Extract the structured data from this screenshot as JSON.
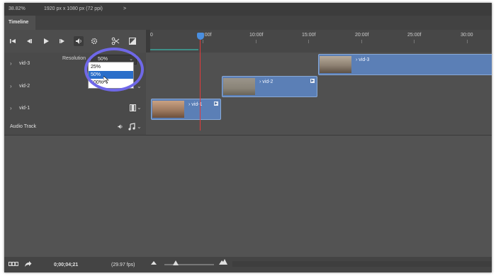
{
  "status": {
    "zoom": "38.82%",
    "doc_info": "1920 px x 1080 px (72 ppi)",
    "arrow": ">"
  },
  "tabs": [
    {
      "label": "Timeline"
    }
  ],
  "controls": {
    "icons": [
      "first-frame-icon",
      "previous-frame-icon",
      "play-icon",
      "next-frame-icon",
      "speaker-icon",
      "gear-icon",
      "scissors-icon",
      "transition-icon"
    ]
  },
  "ruler": {
    "ticks": [
      "00",
      "05:00f",
      "10:00f",
      "15:00f",
      "20:00f",
      "25:00f",
      "30:00"
    ]
  },
  "resolution": {
    "label": "Resolution",
    "selected": "50%",
    "options": [
      "25%",
      "50%",
      "100%"
    ],
    "highlighted_index": 1
  },
  "tracks": [
    {
      "name": "vid-3"
    },
    {
      "name": "vid-2"
    },
    {
      "name": "vid-1"
    },
    {
      "name": "Audio Track"
    }
  ],
  "clips": [
    {
      "label": "vid-3"
    },
    {
      "label": "vid-2"
    },
    {
      "label": "vid-1"
    }
  ],
  "bottom": {
    "timecode": "0;00;04;21",
    "fps": "(29.97 fps)"
  },
  "colors": {
    "accent": "#6f68e8",
    "playhead": "#e23a3a",
    "clip": "#5b7fb6",
    "selection": "#2a6ec9"
  }
}
